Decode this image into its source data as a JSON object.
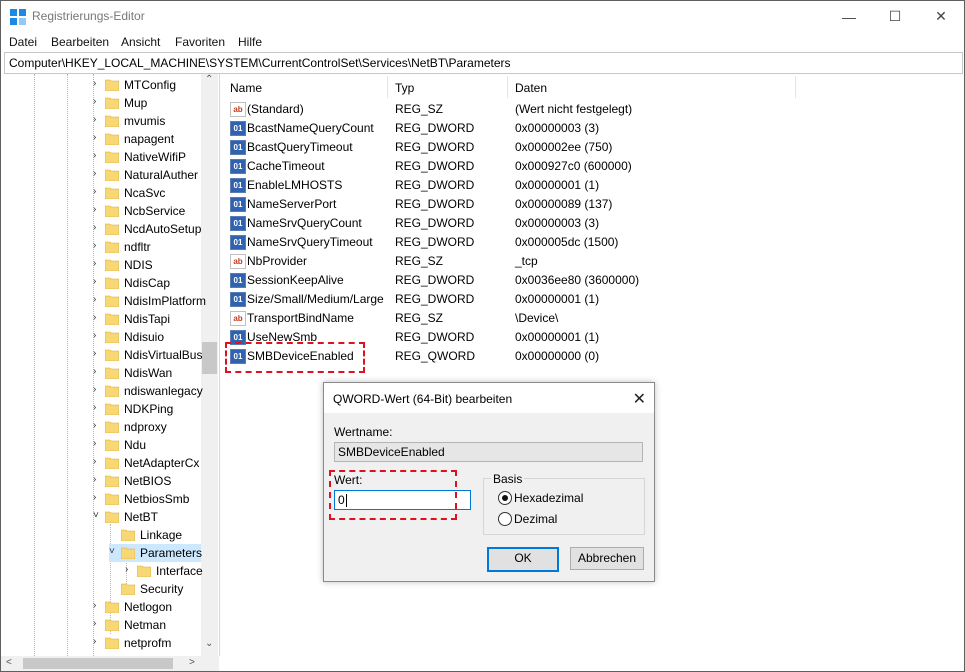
{
  "window": {
    "title": "Registrierungs-Editor"
  },
  "menu": [
    "Datei",
    "Bearbeiten",
    "Ansicht",
    "Favoriten",
    "Hilfe"
  ],
  "address": "Computer\\HKEY_LOCAL_MACHINE\\SYSTEM\\CurrentControlSet\\Services\\NetBT\\Parameters",
  "tree": [
    "MTConfig",
    "Mup",
    "mvumis",
    "napagent",
    "NativeWifiP",
    "NaturalAuther",
    "NcaSvc",
    "NcbService",
    "NcdAutoSetup",
    "ndfltr",
    "NDIS",
    "NdisCap",
    "NdisImPlatform",
    "NdisTapi",
    "Ndisuio",
    "NdisVirtualBus",
    "NdisWan",
    "ndiswanlegacy",
    "NDKPing",
    "ndproxy",
    "Ndu",
    "NetAdapterCx",
    "NetBIOS",
    "NetbiosSmb",
    "NetBT",
    "Linkage",
    "Parameters",
    "Interface",
    "Security",
    "Netlogon",
    "Netman",
    "netprofm"
  ],
  "columns": {
    "name": "Name",
    "type": "Typ",
    "data": "Daten"
  },
  "values": [
    {
      "name": "(Standard)",
      "type": "REG_SZ",
      "data": "(Wert nicht festgelegt)",
      "icon": "ab"
    },
    {
      "name": "BcastNameQueryCount",
      "type": "REG_DWORD",
      "data": "0x00000003 (3)",
      "icon": "bin"
    },
    {
      "name": "BcastQueryTimeout",
      "type": "REG_DWORD",
      "data": "0x000002ee (750)",
      "icon": "bin"
    },
    {
      "name": "CacheTimeout",
      "type": "REG_DWORD",
      "data": "0x000927c0 (600000)",
      "icon": "bin"
    },
    {
      "name": "EnableLMHOSTS",
      "type": "REG_DWORD",
      "data": "0x00000001 (1)",
      "icon": "bin"
    },
    {
      "name": "NameServerPort",
      "type": "REG_DWORD",
      "data": "0x00000089 (137)",
      "icon": "bin"
    },
    {
      "name": "NameSrvQueryCount",
      "type": "REG_DWORD",
      "data": "0x00000003 (3)",
      "icon": "bin"
    },
    {
      "name": "NameSrvQueryTimeout",
      "type": "REG_DWORD",
      "data": "0x000005dc (1500)",
      "icon": "bin"
    },
    {
      "name": "NbProvider",
      "type": "REG_SZ",
      "data": "_tcp",
      "icon": "ab"
    },
    {
      "name": "SessionKeepAlive",
      "type": "REG_DWORD",
      "data": "0x0036ee80 (3600000)",
      "icon": "bin"
    },
    {
      "name": "Size/Small/Medium/Large",
      "type": "REG_DWORD",
      "data": "0x00000001 (1)",
      "icon": "bin"
    },
    {
      "name": "TransportBindName",
      "type": "REG_SZ",
      "data": "\\Device\\",
      "icon": "ab"
    },
    {
      "name": "UseNewSmb",
      "type": "REG_DWORD",
      "data": "0x00000001 (1)",
      "icon": "bin"
    },
    {
      "name": "SMBDeviceEnabled",
      "type": "REG_QWORD",
      "data": "0x00000000 (0)",
      "icon": "bin"
    }
  ],
  "dialog": {
    "title": "QWORD-Wert (64-Bit) bearbeiten",
    "name_label": "Wertname:",
    "name_value": "SMBDeviceEnabled",
    "value_label": "Wert:",
    "value": "0",
    "base_label": "Basis",
    "hex_label": "Hexadezimal",
    "dec_label": "Dezimal",
    "selected_base": "Hexadezimal",
    "ok_label": "OK",
    "cancel_label": "Abbrechen"
  },
  "colors": {
    "highlight": "#e01020",
    "selection": "#cce8ff",
    "accent": "#0078d7"
  }
}
